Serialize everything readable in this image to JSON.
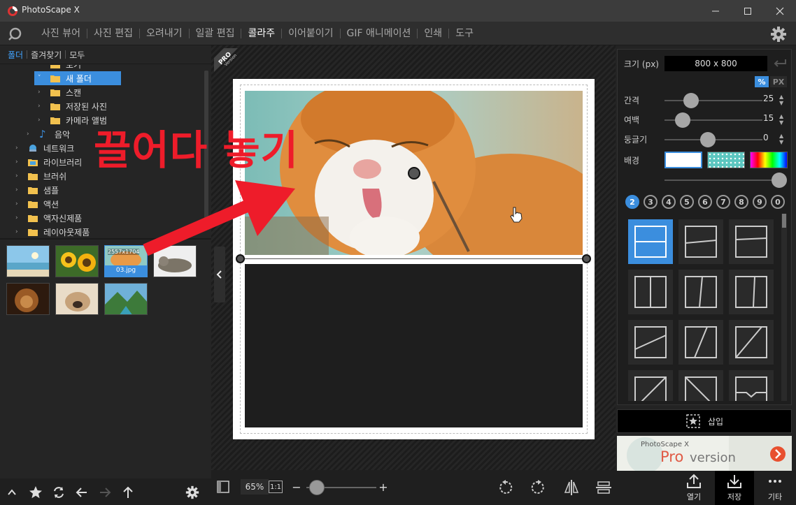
{
  "window": {
    "title": "PhotoScape X"
  },
  "menu": {
    "items": [
      {
        "label": "사진 뷰어"
      },
      {
        "label": "사진 편집"
      },
      {
        "label": "오려내기"
      },
      {
        "label": "일괄 편집"
      },
      {
        "label": "콜라주",
        "active": true
      },
      {
        "label": "이어붙이기"
      },
      {
        "label": "GIF 애니메이션"
      },
      {
        "label": "인쇄"
      },
      {
        "label": "도구"
      }
    ]
  },
  "left_tabs": {
    "folder": "폴더",
    "favorites": "즐겨찾기",
    "all": "모두"
  },
  "tree": {
    "items": [
      {
        "label": "토기"
      },
      {
        "label": "새 폴더",
        "selected": true
      },
      {
        "label": "스캔"
      },
      {
        "label": "저장된 사진"
      },
      {
        "label": "카메라 앨범"
      },
      {
        "label": "음악"
      },
      {
        "label": "네트워크"
      },
      {
        "label": "라이브러리"
      },
      {
        "label": "브러쉬"
      },
      {
        "label": "샘플"
      },
      {
        "label": "액션"
      },
      {
        "label": "액자신제품"
      },
      {
        "label": "레이아웃제품"
      }
    ]
  },
  "thumbnails": {
    "selected_size": "2557x1704",
    "selected_name": "03.jpg"
  },
  "canvas": {
    "pro_badge": "PRO",
    "pro_badge_sub": "Version",
    "annotation_text": "끌어다 놓기"
  },
  "bottom_toolbar": {
    "zoom": "65%",
    "one_to_one": "1:1",
    "zoom_minus": "−",
    "zoom_plus": "+",
    "zoom_level": 0.2,
    "open_label": "열기",
    "save_label": "저장",
    "more_label": "기타"
  },
  "right_panel": {
    "size_label": "크기 (px)",
    "size_value": "800 x 800",
    "unit_percent": "%",
    "unit_px": "PX",
    "spacing_label": "간격",
    "spacing_value": "25",
    "margin_label": "여백",
    "margin_value": "15",
    "round_label": "둥글기",
    "round_value": "0",
    "background_label": "배경",
    "spin_up": "▲",
    "spin_down": "▼",
    "count_options": [
      "2",
      "3",
      "4",
      "5",
      "6",
      "7",
      "8",
      "9",
      "0"
    ],
    "insert_label": "삽입",
    "banner_brand": "PhotoScape X",
    "banner_pro": "Pro",
    "banner_version": "version"
  },
  "colors": {
    "accent": "#3b8ede",
    "annotation": "#ee1c2a"
  }
}
